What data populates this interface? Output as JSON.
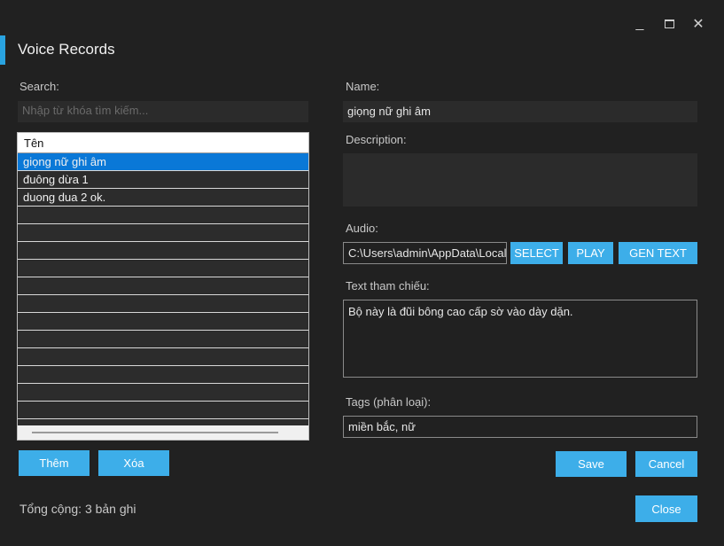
{
  "window": {
    "title": "Voice Records",
    "minimize_glyph": "_",
    "maximize_glyph": "☐",
    "close_glyph": "✕"
  },
  "search": {
    "label": "Search:",
    "placeholder": "Nhập từ khóa tìm kiếm..."
  },
  "table": {
    "header": "Tên",
    "rows": [
      "giọng nữ ghi âm",
      "đuông dừa 1",
      "duong dua 2 ok."
    ],
    "selected_index": 0
  },
  "buttons": {
    "add": "Thêm",
    "delete": "Xóa",
    "select": "SELECT",
    "play": "PLAY",
    "gen_text": "GEN TEXT",
    "save": "Save",
    "cancel": "Cancel",
    "close": "Close"
  },
  "footer": {
    "total": "Tổng cộng: 3 bản ghi"
  },
  "form": {
    "name_label": "Name:",
    "name_value": "giọng nữ ghi âm",
    "description_label": "Description:",
    "description_value": "",
    "audio_label": "Audio:",
    "audio_value": "C:\\Users\\admin\\AppData\\Local",
    "ref_label": "Text tham chiếu:",
    "ref_value": "Bộ này là đũi bông cao cấp sờ vào dày dặn.",
    "tags_label": "Tags (phân loại):",
    "tags_value": "miền bắc, nữ"
  },
  "colors": {
    "accent": "#3daee9",
    "background": "#212121",
    "selection": "#0a78d7"
  }
}
